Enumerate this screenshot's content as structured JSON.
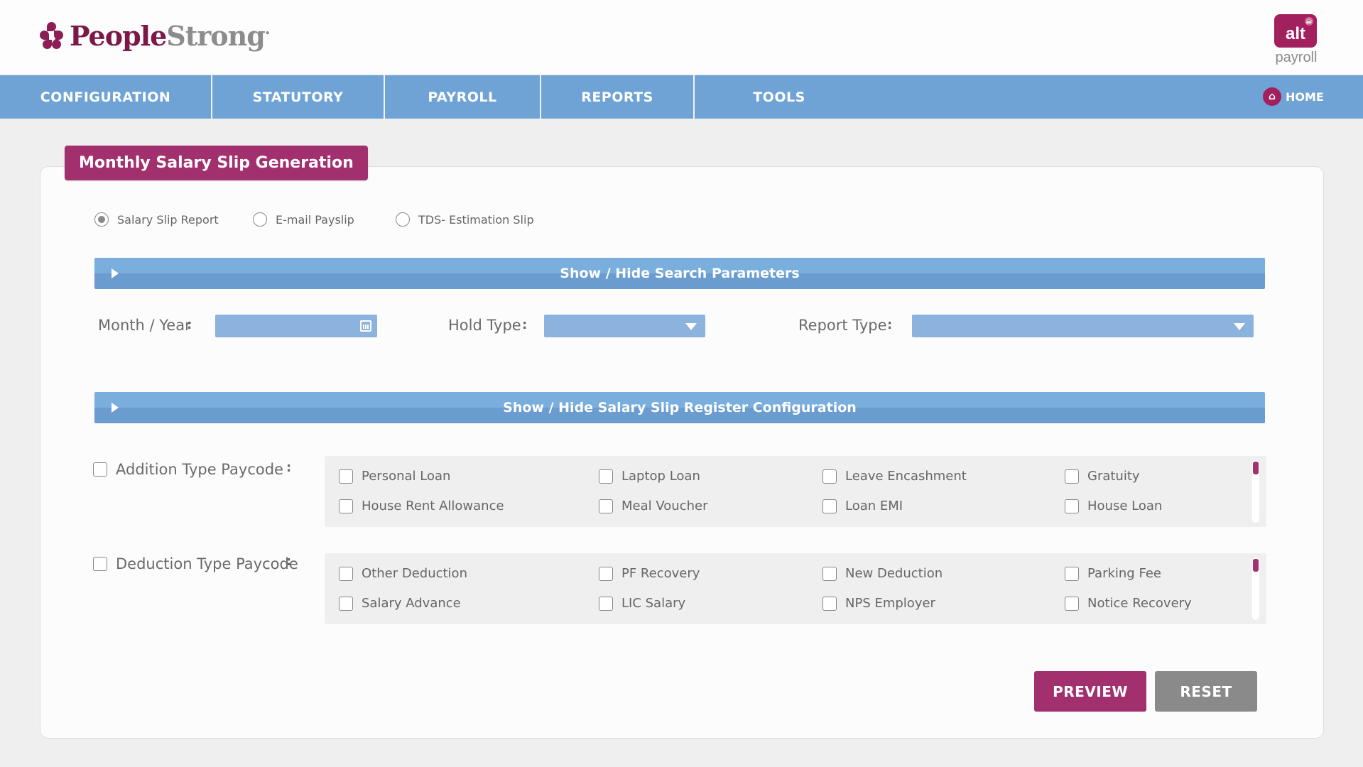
{
  "header": {
    "brand_part1": "People",
    "brand_part2": "Strong",
    "alt_badge": "alt",
    "alt_sub": "payroll"
  },
  "nav": {
    "items": [
      {
        "label": "CONFIGURATION"
      },
      {
        "label": "STATUTORY"
      },
      {
        "label": "PAYROLL"
      },
      {
        "label": "REPORTS"
      },
      {
        "label": "TOOLS"
      }
    ],
    "home_label": "HOME"
  },
  "page": {
    "title": "Monthly Salary Slip Generation"
  },
  "radios": [
    {
      "label": "Salary Slip Report",
      "selected": true
    },
    {
      "label": "E-mail Payslip",
      "selected": false
    },
    {
      "label": "TDS- Estimation Slip",
      "selected": false
    }
  ],
  "search_section": {
    "bar_label": "Show / Hide Search Parameters",
    "month_year_label": "Month / Year",
    "month_year_value": "",
    "hold_type_label": "Hold Type",
    "hold_type_value": "",
    "report_type_label": "Report Type",
    "report_type_value": "",
    "colon": ":"
  },
  "register_section": {
    "bar_label": "Show / Hide Salary Slip Register Configuration",
    "addition": {
      "label": "Addition Type Paycode",
      "items": [
        "Personal Loan",
        "Laptop Loan",
        "Leave Encashment",
        "Gratuity",
        "House Rent Allowance",
        "Meal Voucher",
        "Loan EMI",
        "House Loan"
      ]
    },
    "deduction": {
      "label": "Deduction Type Paycode",
      "items": [
        "Other Deduction",
        "PF Recovery",
        "New Deduction",
        "Parking Fee",
        "Salary Advance",
        "LIC Salary",
        "NPS Employer",
        "Notice Recovery"
      ]
    }
  },
  "actions": {
    "preview_label": "PREVIEW",
    "reset_label": "RESET"
  },
  "colors": {
    "brand": "#7b1848",
    "accent": "#a3306e",
    "nav": "#6fa3d5",
    "field": "#8bb3de",
    "reset": "#8a8a8a"
  }
}
